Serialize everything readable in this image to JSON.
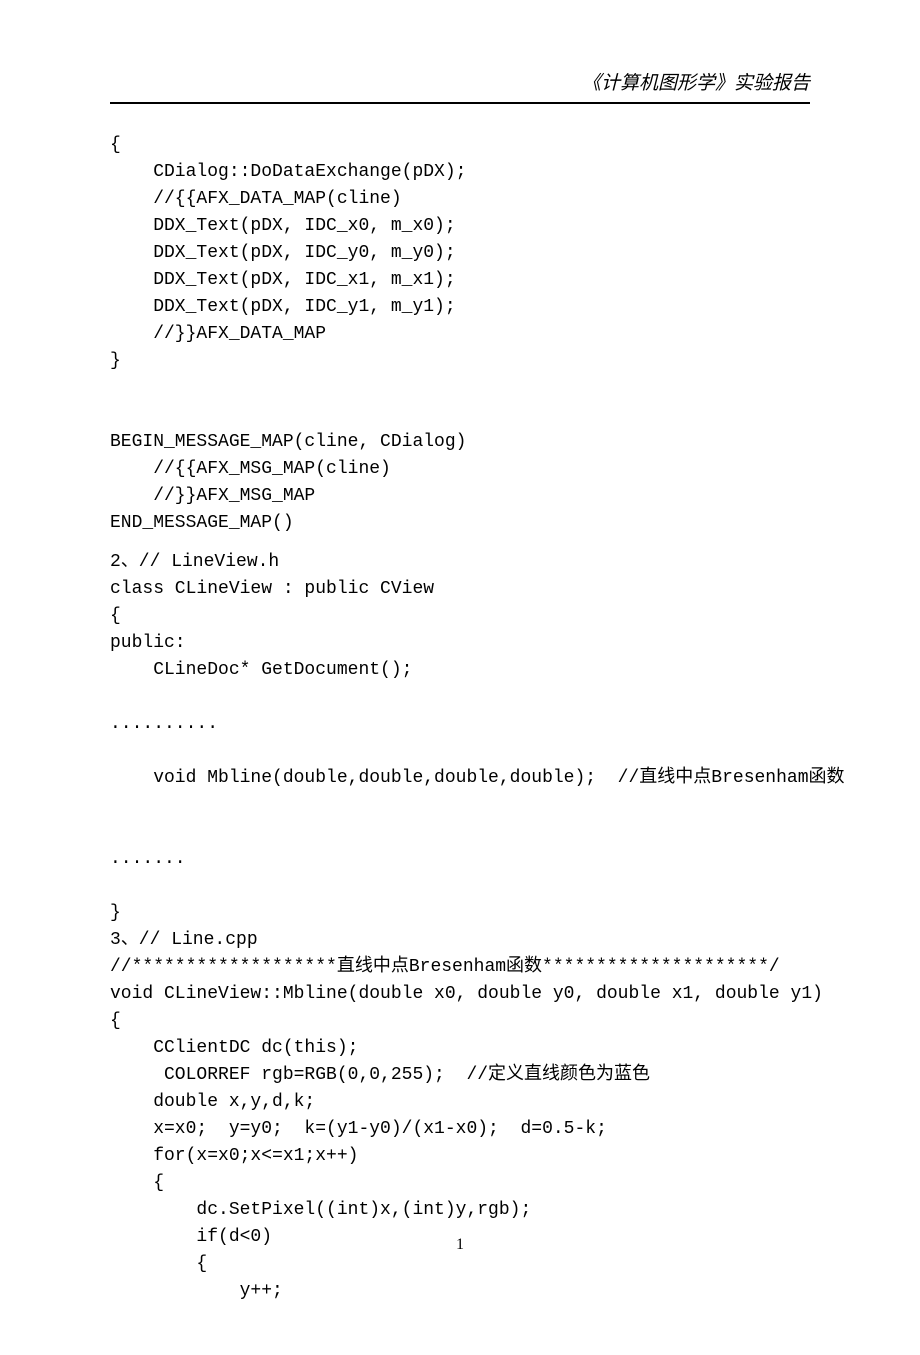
{
  "header": {
    "title": "《计算机图形学》实验报告"
  },
  "code": {
    "block1": "{\n    CDialog::DoDataExchange(pDX);\n    //{{AFX_DATA_MAP(cline)\n    DDX_Text(pDX, IDC_x0, m_x0);\n    DDX_Text(pDX, IDC_y0, m_y0);\n    DDX_Text(pDX, IDC_x1, m_x1);\n    DDX_Text(pDX, IDC_y1, m_y1);\n    //}}AFX_DATA_MAP\n}\n\n\nBEGIN_MESSAGE_MAP(cline, CDialog)\n    //{{AFX_MSG_MAP(cline)\n    //}}AFX_MSG_MAP\nEND_MESSAGE_MAP()",
    "section2_title": "2、// LineView.h",
    "block2": "class CLineView : public CView\n{\npublic:\n    CLineDoc* GetDocument();\n\n..........    \n\n    void Mbline(double,double,double,double);  //直线中点Bresenham函数\n\n\n.......\n\n}",
    "section3_title": "3、// Line.cpp",
    "block3": "//*******************直线中点Bresenham函数*********************/\nvoid CLineView::Mbline(double x0, double y0, double x1, double y1) \n{\n    CClientDC dc(this);\n     COLORREF rgb=RGB(0,0,255);  //定义直线颜色为蓝色\n    double x,y,d,k;\n    x=x0;  y=y0;  k=(y1-y0)/(x1-x0);  d=0.5-k;\n    for(x=x0;x<=x1;x++)\n    {\n        dc.SetPixel((int)x,(int)y,rgb);\n        if(d<0)\n        {\n            y++;"
  },
  "page_number": "1"
}
